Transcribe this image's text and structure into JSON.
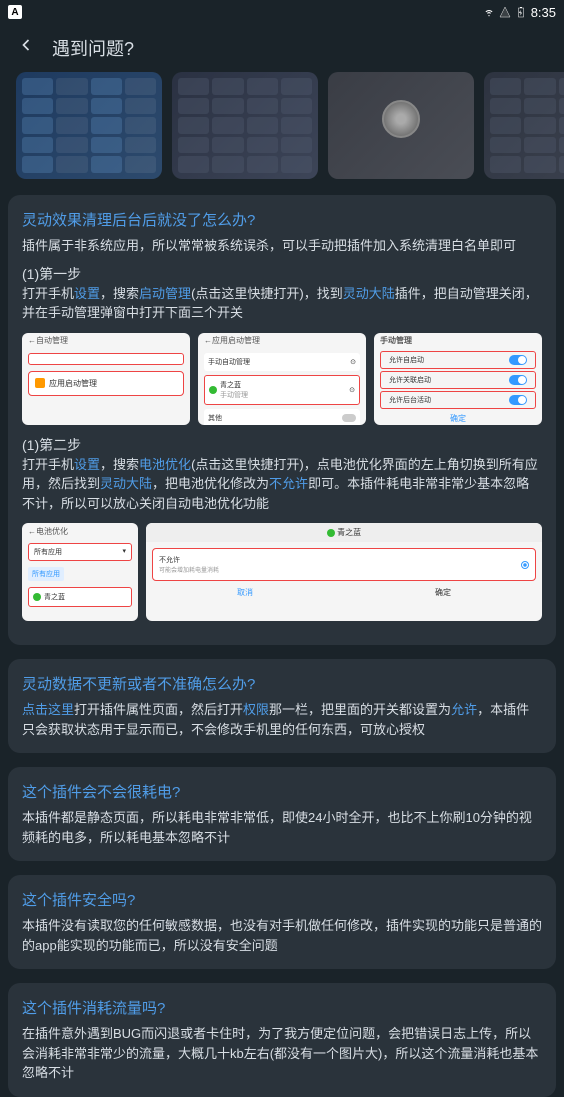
{
  "statusBar": {
    "appIndicator": "A",
    "time": "8:35"
  },
  "header": {
    "title": "遇到问题?"
  },
  "cards": {
    "card1": {
      "title": "灵动效果清理后台后就没了怎么办?",
      "intro": "插件属于非系统应用，所以常常被系统误杀，可以手动把插件加入系统清理白名单即可",
      "step1Label": "(1)第一步",
      "step1_p1": "打开手机",
      "step1_link1": "设置",
      "step1_p2": "，搜索",
      "step1_link2": "启动管理",
      "step1_p3": "(点击这里快捷打开)，找到",
      "step1_link3": "灵动大陆",
      "step1_p4": "插件，把自动管理关闭，并在手动管理弹窗中打开下面三个开关",
      "step2Label": "(1)第二步",
      "step2_p1": "打开手机",
      "step2_link1": "设置",
      "step2_p2": "，搜索",
      "step2_link2": "电池优化",
      "step2_p3": "(点击这里快捷打开)，点电池优化界面的左上角切换到所有应用，然后找到",
      "step2_link3": "灵动大陆",
      "step2_p4": "，把电池优化修改为",
      "step2_link4": "不允许",
      "step2_p5": "即可。本插件耗电非常非常少基本忽略不计，所以可以放心关闭自动电池优化功能"
    },
    "card2": {
      "title": "灵动数据不更新或者不准确怎么办?",
      "link1": "点击这里",
      "p1": "打开插件属性页面，然后打开",
      "link2": "权限",
      "p2": "那一栏，把里面的开关都设置为",
      "link3": "允许",
      "p3": "，本插件只会获取状态用于显示而已，不会修改手机里的任何东西，可放心授权"
    },
    "card3": {
      "title": "这个插件会不会很耗电?",
      "text": "本插件都是静态页面，所以耗电非常非常低，即使24小时全开，也比不上你刷10分钟的视频耗的电多，所以耗电基本忽略不计"
    },
    "card4": {
      "title": "这个插件安全吗?",
      "text": "本插件没有读取您的任何敏感数据，也没有对手机做任何修改，插件实现的功能只是普通的的app能实现的功能而已，所以没有安全问题"
    },
    "card5": {
      "title": "这个插件消耗流量吗?",
      "text": "在插件意外遇到BUG而闪退或者卡住时，为了我方便定位问题，会把错误日志上传，所以会消耗非常非常少的流量，大概几十kb左右(都没有一个图片大)，所以这个流量消耗也基本忽略不计"
    }
  },
  "screenshots": {
    "sc1": {
      "header": "自动管理",
      "item": "应用启动管理"
    },
    "sc2": {
      "header": "应用启动管理",
      "sub1": "手动自动管理",
      "item": "青之蓝",
      "itemSub": "手动管理",
      "other": "其他"
    },
    "sc3": {
      "title": "手动管理",
      "opt1": "允许自启动",
      "opt2": "允许关联启动",
      "opt3": "允许后台活动",
      "confirm": "确定"
    },
    "sc4": {
      "header": "电池优化",
      "dropdown": "所有应用",
      "tag": "所有应用",
      "item": "青之蓝"
    },
    "sc5": {
      "title": "青之蓝",
      "optTitle": "不允许",
      "optSub": "可能会增加耗电量消耗",
      "cancel": "取消",
      "ok": "确定"
    }
  }
}
